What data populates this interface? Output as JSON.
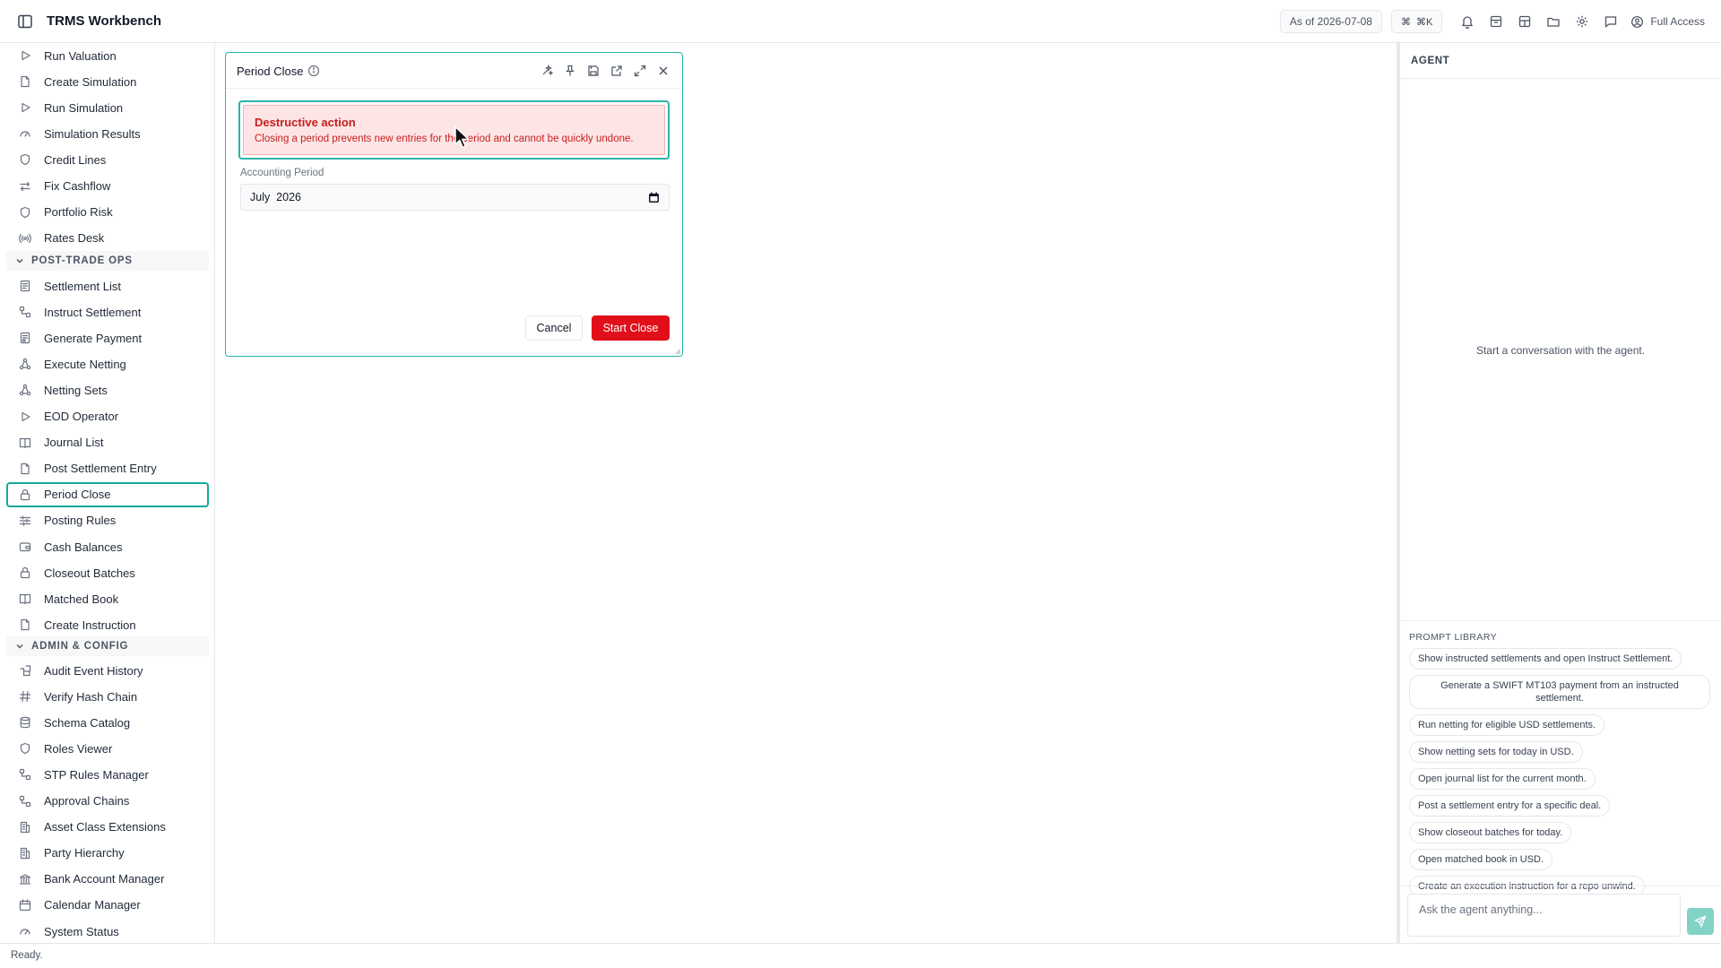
{
  "app": {
    "title": "TRMS Workbench",
    "as_of": "As of 2026-07-08",
    "shortcut": "⌘K",
    "access": "Full Access",
    "accent": "#14a89a"
  },
  "sidebar": {
    "items_top": [
      {
        "label": "Run Valuation",
        "icon": "play-icon"
      },
      {
        "label": "Create Simulation",
        "icon": "file-icon"
      },
      {
        "label": "Run Simulation",
        "icon": "play-icon"
      },
      {
        "label": "Simulation Results",
        "icon": "gauge-icon"
      },
      {
        "label": "Credit Lines",
        "icon": "shield-icon"
      },
      {
        "label": "Fix Cashflow",
        "icon": "arrows-icon"
      },
      {
        "label": "Portfolio Risk",
        "icon": "shield-icon"
      },
      {
        "label": "Rates Desk",
        "icon": "radio-icon"
      }
    ],
    "section_post_trade": "POST-TRADE OPS",
    "items_post_trade": [
      {
        "label": "Settlement List",
        "icon": "list-icon"
      },
      {
        "label": "Instruct Settlement",
        "icon": "workflow-icon"
      },
      {
        "label": "Generate Payment",
        "icon": "receipt-icon"
      },
      {
        "label": "Execute Netting",
        "icon": "network-icon"
      },
      {
        "label": "Netting Sets",
        "icon": "network-icon"
      },
      {
        "label": "EOD Operator",
        "icon": "play-icon"
      },
      {
        "label": "Journal List",
        "icon": "book-icon"
      },
      {
        "label": "Post Settlement Entry",
        "icon": "file-icon"
      },
      {
        "label": "Period Close",
        "icon": "lock-icon",
        "active": true
      },
      {
        "label": "Posting Rules",
        "icon": "sliders-icon"
      },
      {
        "label": "Cash Balances",
        "icon": "wallet-icon"
      },
      {
        "label": "Closeout Batches",
        "icon": "lock-icon"
      },
      {
        "label": "Matched Book",
        "icon": "book-icon"
      },
      {
        "label": "Create Instruction",
        "icon": "file-icon"
      }
    ],
    "section_admin": "ADMIN & CONFIG",
    "items_admin": [
      {
        "label": "Audit Event History",
        "icon": "history-icon"
      },
      {
        "label": "Verify Hash Chain",
        "icon": "hash-icon"
      },
      {
        "label": "Schema Catalog",
        "icon": "database-icon"
      },
      {
        "label": "Roles Viewer",
        "icon": "shield-icon"
      },
      {
        "label": "STP Rules Manager",
        "icon": "workflow-icon"
      },
      {
        "label": "Approval Chains",
        "icon": "workflow-icon"
      },
      {
        "label": "Asset Class Extensions",
        "icon": "building-icon"
      },
      {
        "label": "Party Hierarchy",
        "icon": "building-icon"
      },
      {
        "label": "Bank Account Manager",
        "icon": "bank-icon"
      },
      {
        "label": "Calendar Manager",
        "icon": "calendar-icon"
      },
      {
        "label": "System Status",
        "icon": "gauge-icon"
      }
    ]
  },
  "dialog": {
    "title": "Period Close",
    "warning_title": "Destructive action",
    "warning_text": "Closing a period prevents new entries for the period and cannot be quickly undone.",
    "field_label": "Accounting Period",
    "field_value": "July  2026",
    "cancel_label": "Cancel",
    "start_label": "Start Close",
    "danger_color": "#e10f1a"
  },
  "agent": {
    "header": "AGENT",
    "empty_text": "Start a conversation with the agent.",
    "prompt_library_title": "PROMPT LIBRARY",
    "prompts": [
      "Show instructed settlements and open Instruct Settlement.",
      "Generate a SWIFT MT103 payment from an instructed settlement.",
      "Run netting for eligible USD settlements.",
      "Show netting sets for today in USD.",
      "Open journal list for the current month.",
      "Post a settlement entry for a specific deal.",
      "Show closeout batches for today.",
      "Open matched book in USD.",
      "Create an execution instruction for a repo unwind."
    ],
    "input_placeholder": "Ask the agent anything..."
  },
  "status": {
    "text": "Ready."
  }
}
